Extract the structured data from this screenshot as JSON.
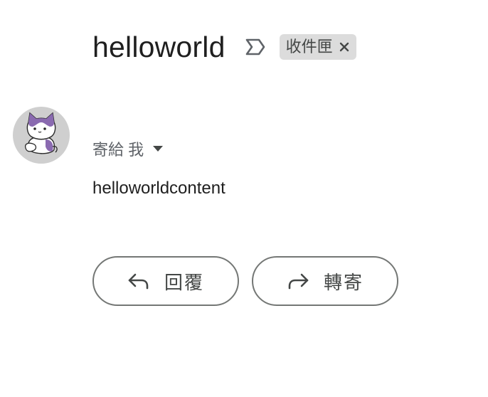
{
  "email": {
    "subject": "helloworld",
    "label_chip": "收件匣",
    "recipient_text": "寄給 我",
    "body": "helloworldcontent"
  },
  "actions": {
    "reply_label": "回覆",
    "forward_label": "轉寄"
  },
  "icons": {
    "importance": "importance-marker-icon",
    "chip_close": "close-icon",
    "dropdown": "caret-down-icon",
    "reply": "reply-arrow-icon",
    "forward": "forward-arrow-icon",
    "avatar": "cat-avatar"
  },
  "colors": {
    "chip_bg": "#dcdcdc",
    "avatar_bg": "#cfcfcf",
    "cat_purple": "#8a6ab0",
    "button_border": "#747775"
  }
}
